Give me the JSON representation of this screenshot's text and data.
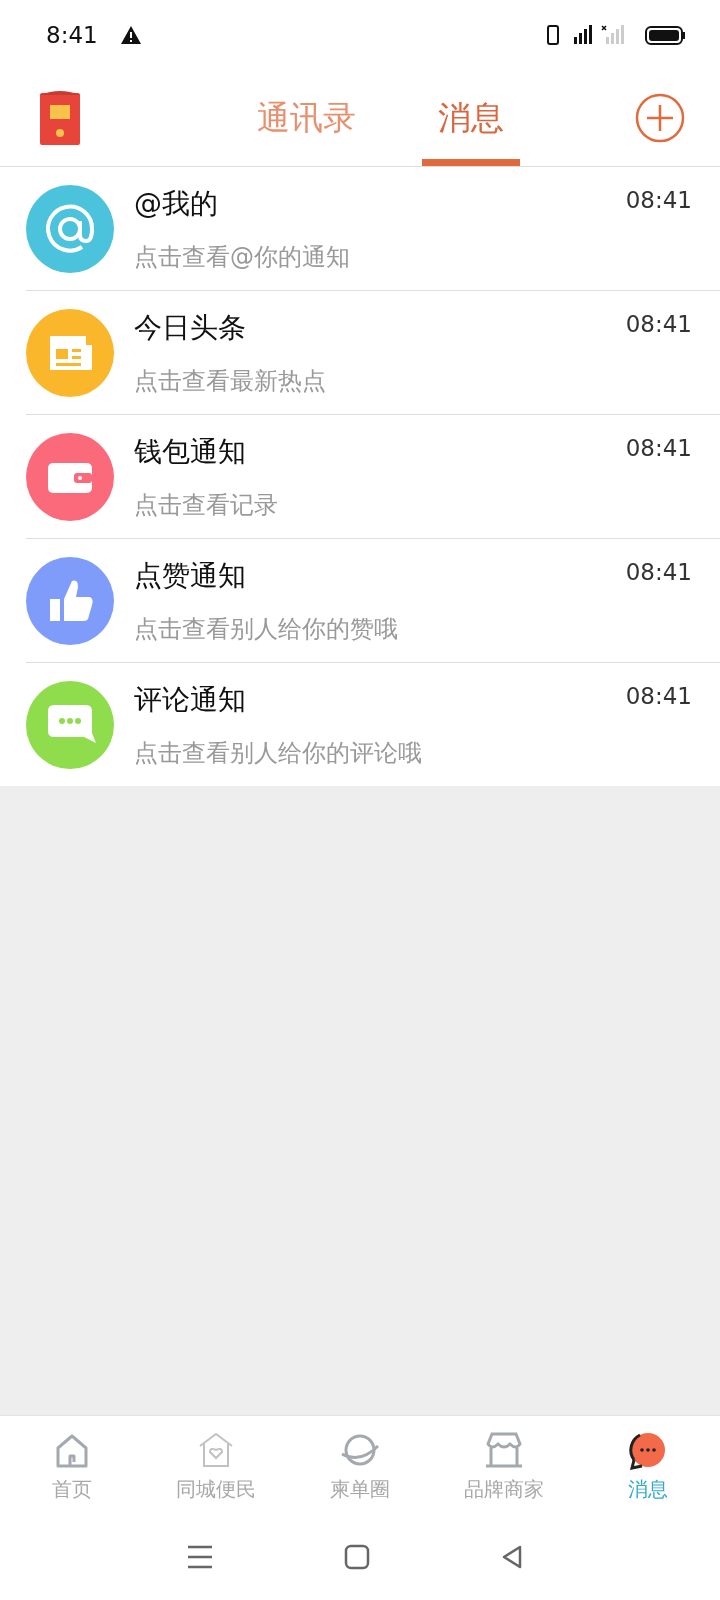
{
  "status_bar": {
    "time": "8:41"
  },
  "header": {
    "tabs": [
      {
        "label": "通讯录",
        "selected": false
      },
      {
        "label": "消息",
        "selected": true
      }
    ]
  },
  "messages": [
    {
      "kind": "at",
      "color": "#4cc3dd",
      "title": "@我的",
      "subtitle": "点击查看@你的通知",
      "time": "08:41"
    },
    {
      "kind": "news",
      "color": "#fbb72b",
      "title": "今日头条",
      "subtitle": "点击查看最新热点",
      "time": "08:41"
    },
    {
      "kind": "wallet",
      "color": "#fb6a7a",
      "title": "钱包通知",
      "subtitle": "点击查看记录",
      "time": "08:41"
    },
    {
      "kind": "like",
      "color": "#7f9cfb",
      "title": "点赞通知",
      "subtitle": "点击查看别人给你的赞哦",
      "time": "08:41"
    },
    {
      "kind": "comment",
      "color": "#8fdc4d",
      "title": "评论通知",
      "subtitle": "点击查看别人给你的评论哦",
      "time": "08:41"
    }
  ],
  "bottom_nav": [
    {
      "kind": "home",
      "label": "首页",
      "selected": false
    },
    {
      "kind": "city",
      "label": "同城便民",
      "selected": false
    },
    {
      "kind": "planet",
      "label": "柬单圈",
      "selected": false
    },
    {
      "kind": "shop",
      "label": "品牌商家",
      "selected": false
    },
    {
      "kind": "chat",
      "label": "消息",
      "selected": true
    }
  ]
}
